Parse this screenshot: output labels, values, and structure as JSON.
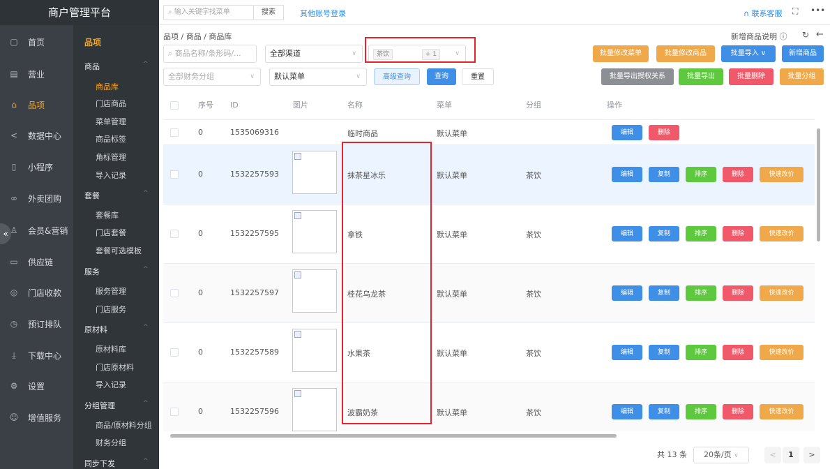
{
  "app_title": "商户管理平台",
  "topbar": {
    "search_placeholder": "输入关键字找菜单",
    "search_button": "搜索",
    "other_login": "其他账号登录",
    "contact": "联系客服"
  },
  "nav_primary": [
    {
      "label": "首页",
      "icon": "doc-icon"
    },
    {
      "label": "营业",
      "icon": "calendar-icon"
    },
    {
      "label": "品项",
      "icon": "bag-icon",
      "active": true
    },
    {
      "label": "数据中心",
      "icon": "share-icon"
    },
    {
      "label": "小程序",
      "icon": "phone-icon"
    },
    {
      "label": "外卖团购",
      "icon": "bike-icon"
    },
    {
      "label": "会员&营销",
      "icon": "user-icon"
    },
    {
      "label": "供应链",
      "icon": "truck-icon"
    },
    {
      "label": "门店收款",
      "icon": "wallet-icon"
    },
    {
      "label": "预订排队",
      "icon": "clock-icon"
    },
    {
      "label": "下载中心",
      "icon": "download-icon"
    },
    {
      "label": "设置",
      "icon": "gear-icon"
    },
    {
      "label": "增值服务",
      "icon": "smile-icon"
    }
  ],
  "nav_secondary": {
    "title": "品项",
    "sections": [
      {
        "label": "商品",
        "items": [
          "商品库",
          "门店商品",
          "菜单管理",
          "商品标签",
          "角标管理",
          "导入记录"
        ]
      },
      {
        "label": "套餐",
        "items": [
          "套餐库",
          "门店套餐",
          "套餐可选模板"
        ]
      },
      {
        "label": "服务",
        "items": [
          "服务管理",
          "门店服务"
        ]
      },
      {
        "label": "原材料",
        "items": [
          "原材料库",
          "门店原材料",
          "导入记录"
        ]
      },
      {
        "label": "分组管理",
        "items": [
          "商品/原材料分组",
          "财务分组"
        ]
      },
      {
        "label": "同步下发",
        "items": []
      }
    ],
    "active_item": "商品库"
  },
  "breadcrumb": [
    "品项",
    "商品",
    "商品库"
  ],
  "help_text": "新增商品说明",
  "filters": {
    "name_placeholder": "商品名称/条形码/...",
    "channel": "全部渠道",
    "group_tag": "茶饮",
    "group_more": "+ 1",
    "finance_placeholder": "全部财务分组",
    "menu": "默认菜单",
    "advanced": "高级查询",
    "query": "查询",
    "reset": "重置"
  },
  "actions_top": [
    "批量修改菜单",
    "批量修改商品",
    "批量导入 ∨",
    "新增商品"
  ],
  "actions_bottom": [
    "批量导出授权关系",
    "批量导出",
    "批量删除",
    "批量分组"
  ],
  "table": {
    "headers": [
      "序号",
      "ID",
      "图片",
      "名称",
      "菜单",
      "分组",
      "操作"
    ],
    "rows": [
      {
        "seq": "0",
        "id": "1535069316",
        "name": "临时商品",
        "menu": "默认菜单",
        "group": "",
        "ops": [
          "编辑",
          "删除"
        ]
      },
      {
        "seq": "0",
        "id": "1532257593",
        "name": "抹茶星冰乐",
        "menu": "默认菜单",
        "group": "茶饮",
        "ops": [
          "编辑",
          "复制",
          "排序",
          "删除",
          "快速改价"
        ]
      },
      {
        "seq": "0",
        "id": "1532257595",
        "name": "拿铁",
        "menu": "默认菜单",
        "group": "茶饮",
        "ops": [
          "编辑",
          "复制",
          "排序",
          "删除",
          "快速改价"
        ]
      },
      {
        "seq": "0",
        "id": "1532257597",
        "name": "桂花乌龙茶",
        "menu": "默认菜单",
        "group": "茶饮",
        "ops": [
          "编辑",
          "复制",
          "排序",
          "删除",
          "快速改价"
        ]
      },
      {
        "seq": "0",
        "id": "1532257589",
        "name": "水果茶",
        "menu": "默认菜单",
        "group": "茶饮",
        "ops": [
          "编辑",
          "复制",
          "排序",
          "删除",
          "快速改价"
        ]
      },
      {
        "seq": "0",
        "id": "1532257596",
        "name": "波霸奶茶",
        "menu": "默认菜单",
        "group": "茶饮",
        "ops": [
          "编辑",
          "复制",
          "排序",
          "删除",
          "快速改价"
        ]
      }
    ]
  },
  "pager": {
    "total": "共 13 条",
    "page_size": "20条/页",
    "current": "1"
  },
  "colors": {
    "accent": "#f5a623",
    "primary": "#3f8fe6",
    "highlight": "#e8232b"
  }
}
